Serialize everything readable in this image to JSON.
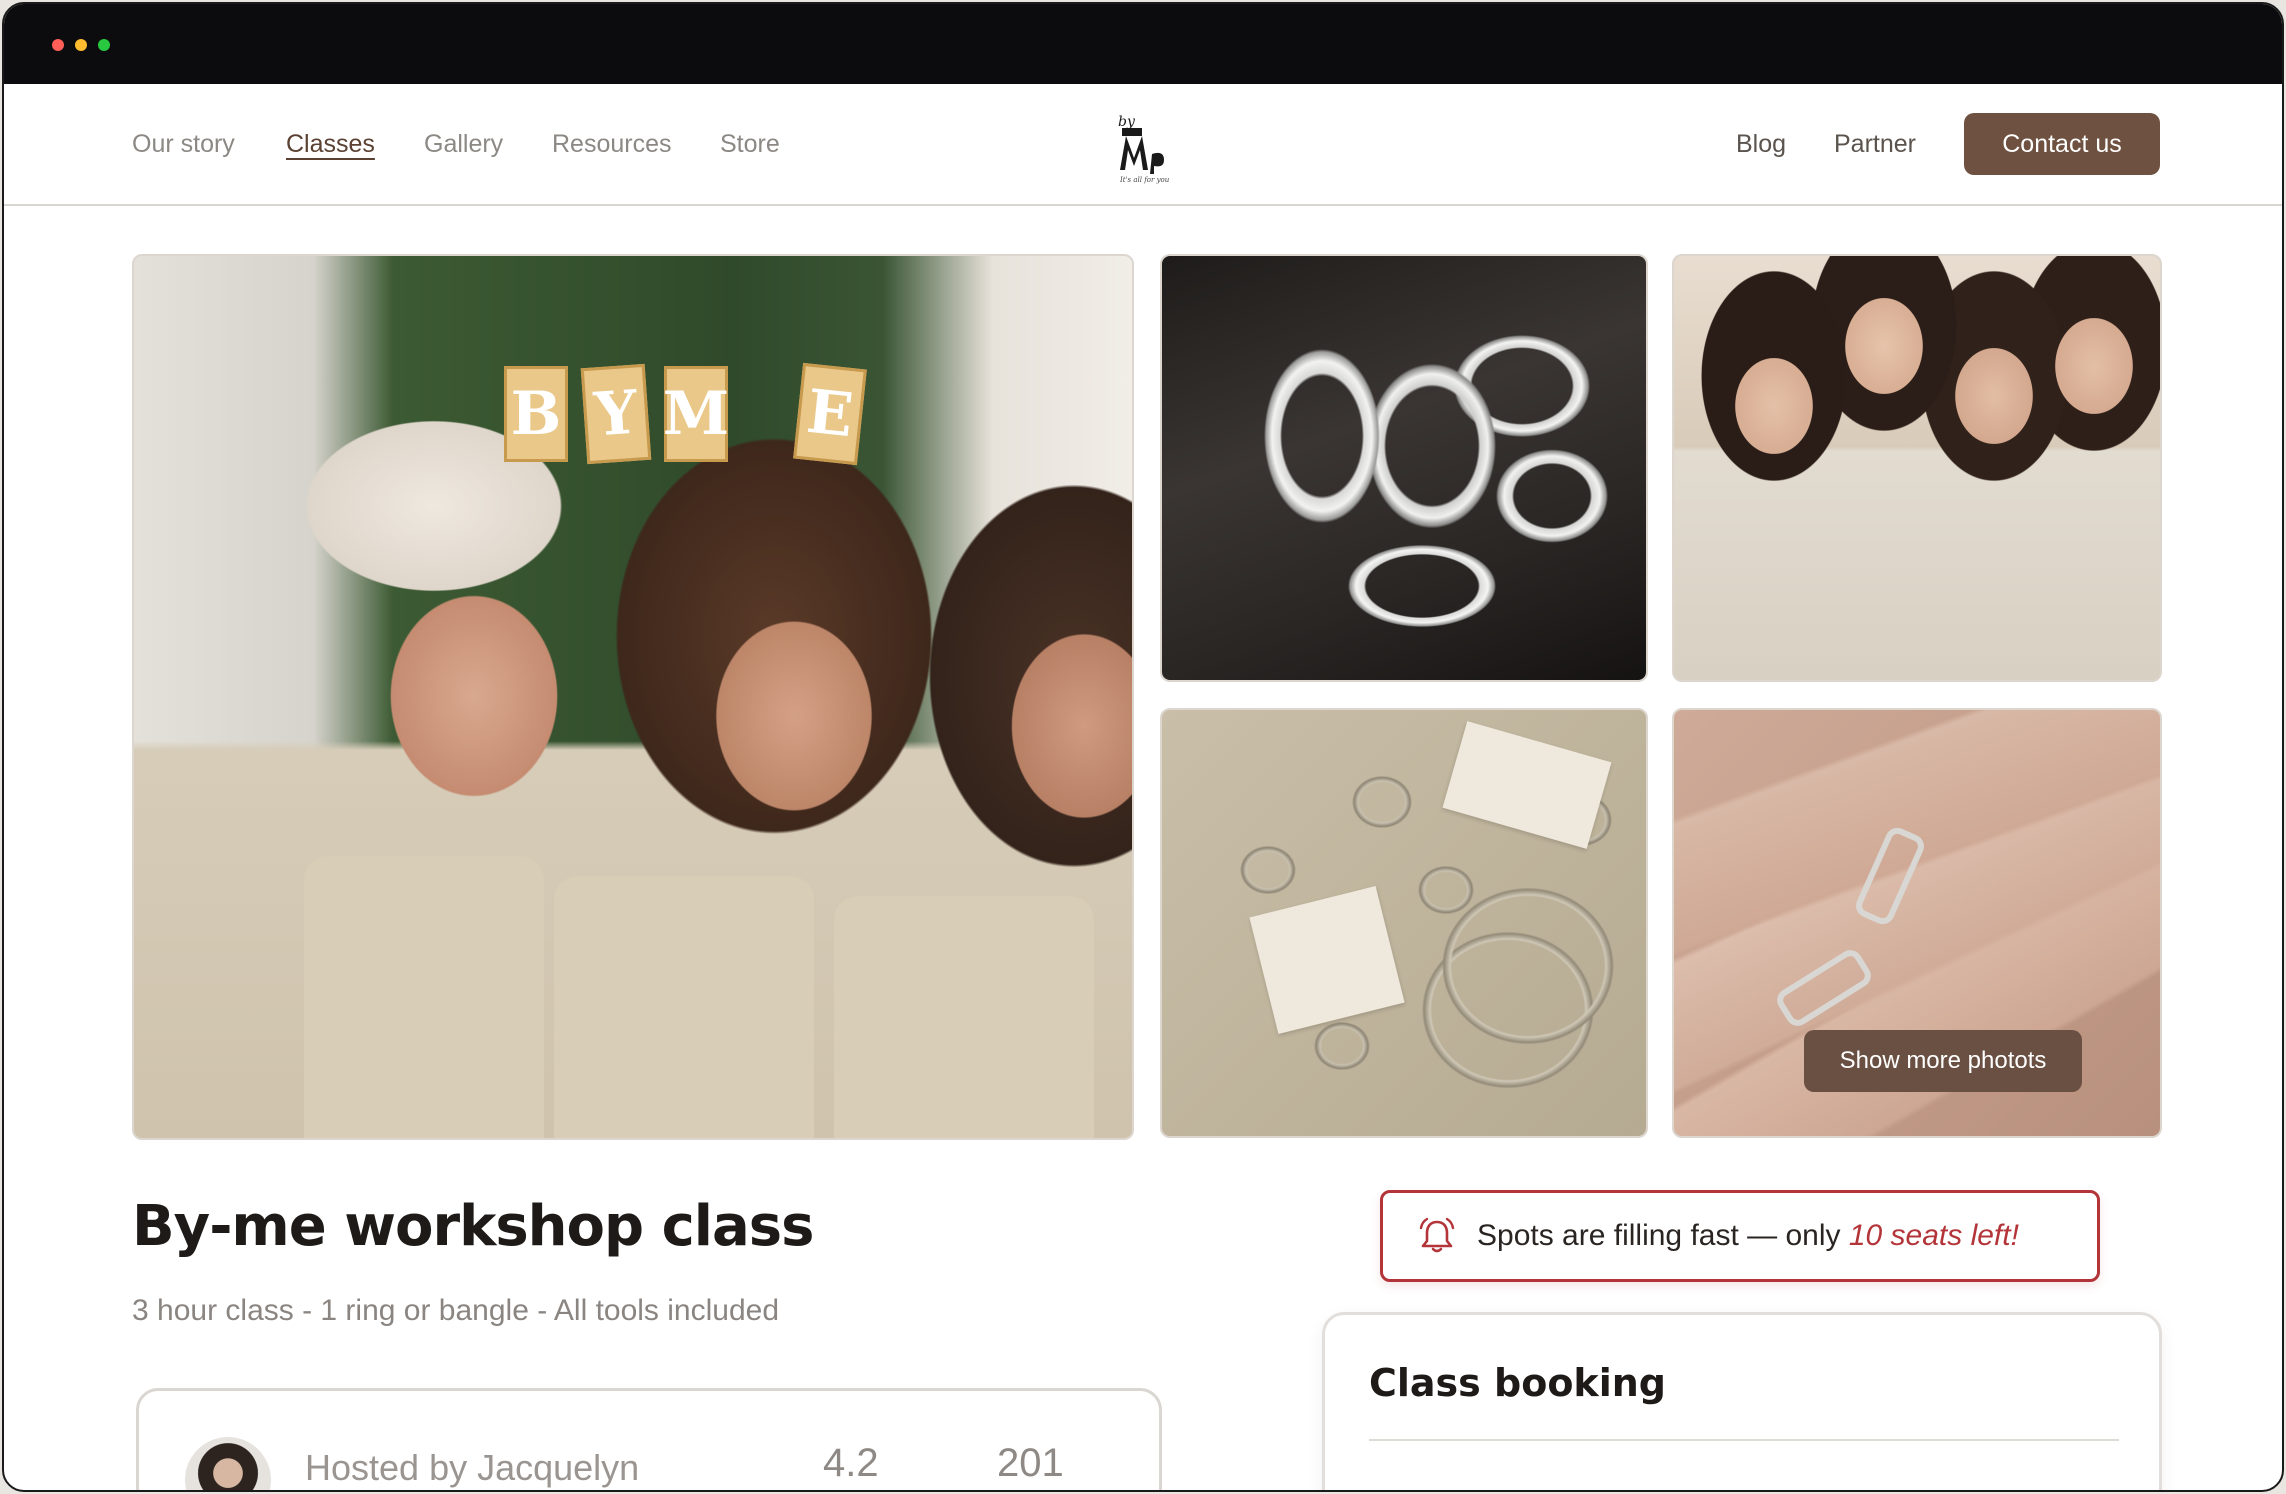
{
  "nav": {
    "left_links": [
      "Our story",
      "Classes",
      "Gallery",
      "Resources",
      "Store"
    ],
    "active_link": "Classes",
    "right_links": [
      "Blog",
      "Partner"
    ],
    "contact_label": "Contact us"
  },
  "brand": {
    "logo_icon": "by-me-logo",
    "logo_text_line": "It's all for you"
  },
  "gallery": {
    "show_more_label": "Show more photots",
    "photos": [
      "workshop-group-photo",
      "stamped-rings-photo",
      "students-with-hammers-photo",
      "bangles-and-rings-photo",
      "ring-on-hand-photo"
    ]
  },
  "class": {
    "title": "By-me workshop class",
    "subtitle": "3 hour class - 1 ring or bangle - All tools included"
  },
  "host": {
    "label": "Hosted by Jacquelyn",
    "rating": "4.2",
    "count": "201"
  },
  "alert": {
    "icon": "bell-icon",
    "text": "Spots are filling fast — only ",
    "emphasis": "10 seats left!"
  },
  "booking": {
    "title": "Class booking"
  },
  "colors": {
    "brand_brown": "#6e5140",
    "alert_red": "#b3353a",
    "titlebar": "#0c0c0e"
  }
}
